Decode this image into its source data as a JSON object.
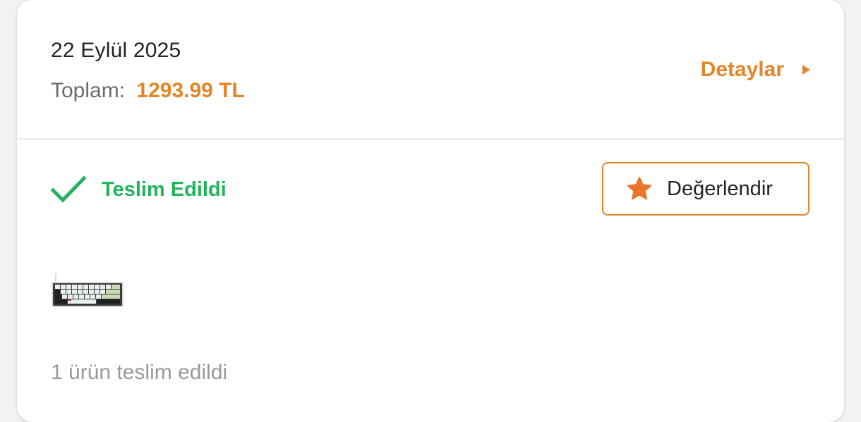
{
  "order": {
    "date": "22 Eylül 2025",
    "total_label": "Toplam:",
    "total_value": "1293.99 TL",
    "details_label": "Detaylar"
  },
  "status": {
    "label": "Teslim Edildi",
    "icon": "check-icon"
  },
  "rate_button": {
    "label": "Değerlendir",
    "icon": "star-icon"
  },
  "product": {
    "thumbnail": "keyboard-thumbnail"
  },
  "footer": {
    "delivered_text": "1 ürün teslim edildi"
  },
  "colors": {
    "accent": "#e38628",
    "success": "#23b35a",
    "muted": "#999999"
  }
}
